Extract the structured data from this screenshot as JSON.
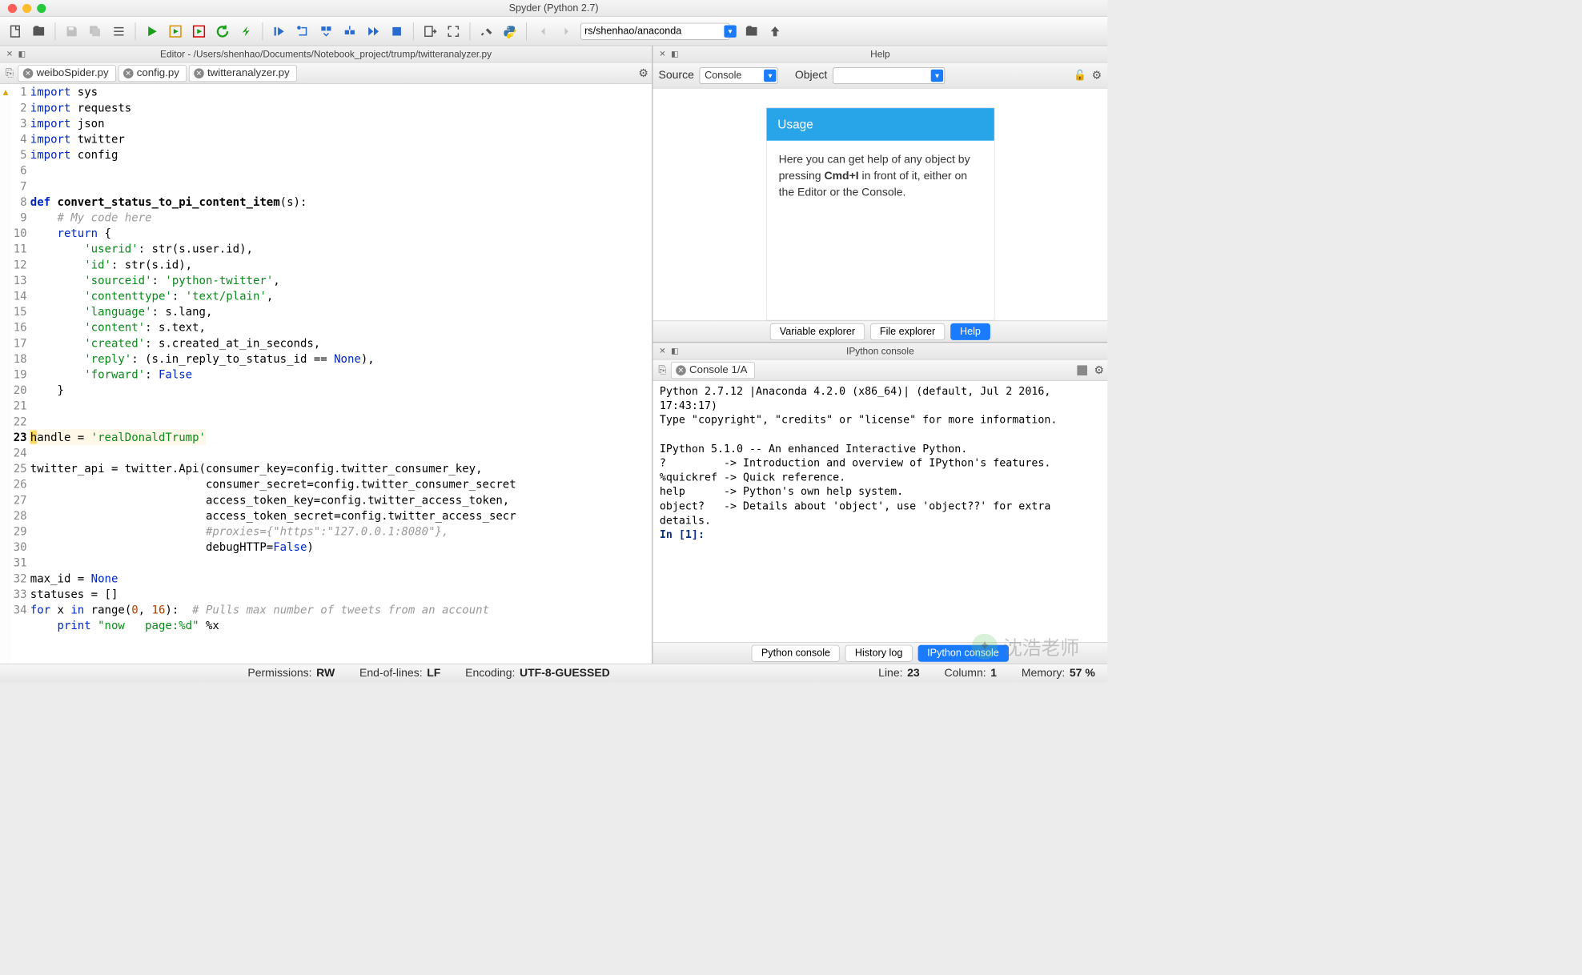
{
  "window_title": "Spyder (Python 2.7)",
  "path_input": "rs/shenhao/anaconda",
  "editor_header": "Editor - /Users/shenhao/Documents/Notebook_project/trump/twitteranalyzer.py",
  "tabs": {
    "t1": "weiboSpider.py",
    "t2": "config.py",
    "t3": "twitteranalyzer.py"
  },
  "line_numbers": [
    "1",
    "2",
    "3",
    "4",
    "5",
    "6",
    "7",
    "8",
    "9",
    "10",
    "11",
    "12",
    "13",
    "14",
    "15",
    "16",
    "17",
    "18",
    "19",
    "20",
    "21",
    "22",
    "23",
    "24",
    "25",
    "26",
    "27",
    "28",
    "29",
    "30",
    "31",
    "32",
    "33",
    "34"
  ],
  "current_line": "23",
  "code": {
    "l1": "import",
    "l1b": " sys",
    "l2": "import",
    "l2b": " requests",
    "l3": "import",
    "l3b": " json",
    "l4": "import",
    "l4b": " twitter",
    "l5": "import",
    "l5b": " config",
    "l8_def": "def ",
    "l8_fn": "convert_status_to_pi_content_item",
    "l8_rest": "(s):",
    "l9_cmt": "    # My code here",
    "l10_kw": "    return",
    "l10_rest": " {",
    "l11a": "        ",
    "l11s": "'userid'",
    "l11b": ": str(s.user.id),",
    "l12a": "        ",
    "l12s": "'id'",
    "l12b": ": str(s.id),",
    "l13a": "        ",
    "l13s": "'sourceid'",
    "l13b": ": ",
    "l13s2": "'python-twitter'",
    "l13c": ",",
    "l14a": "        ",
    "l14s": "'contenttype'",
    "l14b": ": ",
    "l14s2": "'text/plain'",
    "l14c": ",",
    "l15a": "        ",
    "l15s": "'language'",
    "l15b": ": s.lang,",
    "l16a": "        ",
    "l16s": "'content'",
    "l16b": ": s.text,",
    "l17a": "        ",
    "l17s": "'created'",
    "l17b": ": s.created_at_in_seconds,",
    "l18a": "        ",
    "l18s": "'reply'",
    "l18b": ": (s.in_reply_to_status_id == ",
    "l18n": "None",
    "l18c": "),",
    "l19a": "        ",
    "l19s": "'forward'",
    "l19b": ": ",
    "l19f": "False",
    "l20": "    }",
    "l23hl": "h",
    "l23a": "andle = ",
    "l23s": "'realDonaldTrump'",
    "l25": "twitter_api = twitter.Api(consumer_key=config.twitter_consumer_key,",
    "l26": "                          consumer_secret=config.twitter_consumer_secret",
    "l27": "                          access_token_key=config.twitter_access_token,",
    "l28": "                          access_token_secret=config.twitter_access_secr",
    "l29cmt": "                          #proxies={\"https\":\"127.0.0.1:8080\"},",
    "l30a": "                          debugHTTP=",
    "l30f": "False",
    "l30b": ")",
    "l32a": "max_id = ",
    "l32n": "None",
    "l33": "statuses = []",
    "l34a": "for",
    "l34b": " x ",
    "l34c": "in",
    "l34d": " range(",
    "l34n1": "0",
    "l34e": ", ",
    "l34n2": "16",
    "l34f": "):  ",
    "l34cmt": "# Pulls max number of tweets from an account",
    "l35a": "    ",
    "l35k": "print",
    "l35s": " \"now   page:%d\"",
    "l35b": " %x"
  },
  "help": {
    "title": "Help",
    "source_label": "Source",
    "source_value": "Console",
    "object_label": "Object",
    "usage_title": "Usage",
    "usage_body_1": "Here you can get help of any object by pressing ",
    "usage_body_bold": "Cmd+I",
    "usage_body_2": " in front of it, either on the Editor or the Console.",
    "tab1": "Variable explorer",
    "tab2": "File explorer",
    "tab3": "Help"
  },
  "console": {
    "title": "IPython console",
    "tab": "Console 1/A",
    "body": "Python 2.7.12 |Anaconda 4.2.0 (x86_64)| (default, Jul 2 2016, 17:43:17)\nType \"copyright\", \"credits\" or \"license\" for more information.\n\nIPython 5.1.0 -- An enhanced Interactive Python.\n?         -> Introduction and overview of IPython's features.\n%quickref -> Quick reference.\nhelp      -> Python's own help system.\nobject?   -> Details about 'object', use 'object??' for extra details.\n",
    "prompt": "In [1]: ",
    "ptab1": "Python console",
    "ptab2": "History log",
    "ptab3": "IPython console"
  },
  "statusbar": {
    "perm_l": "Permissions:",
    "perm_v": "RW",
    "eol_l": "End-of-lines:",
    "eol_v": "LF",
    "enc_l": "Encoding:",
    "enc_v": "UTF-8-GUESSED",
    "line_l": "Line:",
    "line_v": "23",
    "col_l": "Column:",
    "col_v": "1",
    "mem_l": "Memory:",
    "mem_v": "57 %"
  },
  "watermark": "沈浩老师"
}
